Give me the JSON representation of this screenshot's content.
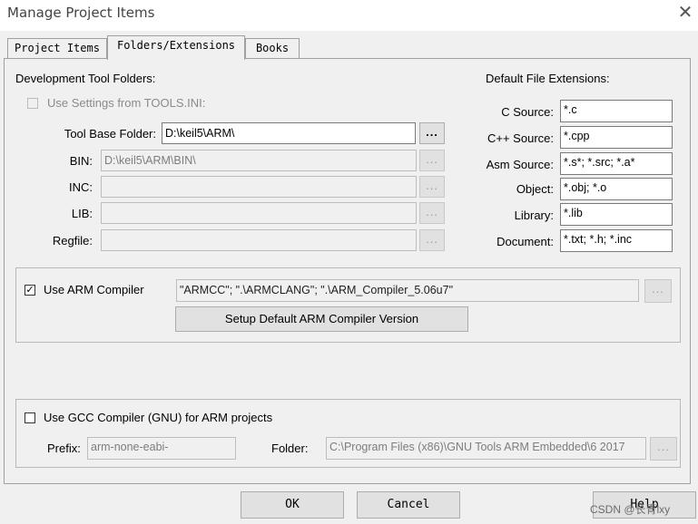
{
  "window": {
    "title": "Manage Project Items"
  },
  "tabs": [
    {
      "label": "Project Items",
      "active": false
    },
    {
      "label": "Folders/Extensions",
      "active": true
    },
    {
      "label": "Books",
      "active": false
    }
  ],
  "tool_folders": {
    "header": "Development Tool Folders:",
    "use_tools_ini": {
      "label": "Use Settings from TOOLS.INI:",
      "checked": false,
      "enabled": false
    },
    "base_folder": {
      "label": "Tool Base Folder:",
      "value": "D:\\keil5\\ARM\\"
    },
    "bin": {
      "label": "BIN:",
      "value": "D:\\keil5\\ARM\\BIN\\"
    },
    "inc": {
      "label": "INC:",
      "value": ""
    },
    "lib": {
      "label": "LIB:",
      "value": ""
    },
    "regfile": {
      "label": "Regfile:",
      "value": ""
    },
    "browse_label": "..."
  },
  "extensions": {
    "header": "Default File Extensions:",
    "c": {
      "label": "C Source:",
      "value": "*.c"
    },
    "cpp": {
      "label": "C++ Source:",
      "value": "*.cpp"
    },
    "asm": {
      "label": "Asm Source:",
      "value": "*.s*; *.src; *.a*"
    },
    "object": {
      "label": "Object:",
      "value": "*.obj; *.o"
    },
    "library": {
      "label": "Library:",
      "value": "*.lib"
    },
    "document": {
      "label": "Document:",
      "value": "*.txt; *.h; *.inc"
    }
  },
  "arm": {
    "checkbox_label": "Use ARM Compiler",
    "checked": true,
    "compiler_value": "\"ARMCC\"; \".\\ARMCLANG\"; \".\\ARM_Compiler_5.06u7\"",
    "setup_button": "Setup Default ARM Compiler Version"
  },
  "gcc": {
    "checkbox_label": "Use GCC Compiler (GNU) for ARM projects",
    "checked": false,
    "prefix_label": "Prefix:",
    "prefix_value": "arm-none-eabi-",
    "folder_label": "Folder:",
    "folder_value": "C:\\Program Files (x86)\\GNU Tools ARM Embedded\\6 2017"
  },
  "footer": {
    "ok": "OK",
    "cancel": "Cancel",
    "help": "Help"
  },
  "watermark": "CSDN @长青lxy",
  "icons": {
    "close": "close-icon",
    "check": "checkmark-icon"
  }
}
